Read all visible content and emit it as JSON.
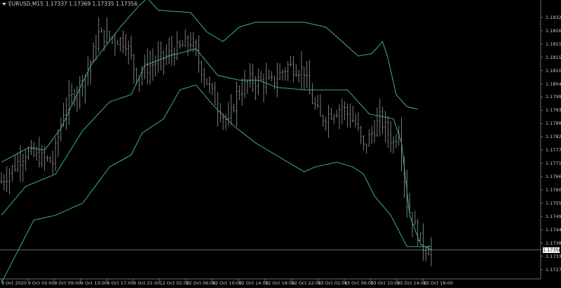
{
  "header": {
    "symbol_timeframe": "EURUSD,M15",
    "ohlc": "1.17337 1.17369 1.17335 1.17356"
  },
  "price_axis": {
    "labels": [
      "1.18320",
      "1.18265",
      "1.18210",
      "1.18155",
      "1.18100",
      "1.18045",
      "1.17990",
      "1.17935",
      "1.17880",
      "1.17825",
      "1.17770",
      "1.17715",
      "1.17660",
      "1.17605",
      "1.17550",
      "1.17495",
      "1.17440",
      "1.17385",
      "1.17330",
      "1.17275"
    ],
    "current_price": "1.17356"
  },
  "time_axis": {
    "labels": [
      "9 Oct 2020",
      "9 Oct 05:00",
      "9 Oct 09:00",
      "9 Oct 13:00",
      "9 Oct 17:00",
      "9 Oct 21:00",
      "12 Oct 02:00",
      "12 Oct 06:00",
      "12 Oct 10:00",
      "12 Oct 14:00",
      "12 Oct 18:00",
      "12 Oct 22:00",
      "13 Oct 02:00",
      "13 Oct 06:00",
      "13 Oct 10:00",
      "13 Oct 14:00",
      "13 Oct 18:00"
    ]
  },
  "colors": {
    "background": "#000000",
    "bars": "#9a9a9a",
    "bands": "#3cb371",
    "axis_text": "#c8c8c8",
    "axis_line": "#6e6e6e"
  },
  "chart_data": {
    "type": "line",
    "symbol": "EURUSD",
    "timeframe": "M15",
    "bar_count": 160,
    "y_range": [
      1.17242,
      1.18369
    ],
    "close_price_path": [
      {
        "bar": 0,
        "price": 1.1764
      },
      {
        "bar": 9,
        "price": 1.1776
      },
      {
        "bar": 19,
        "price": 1.1772
      },
      {
        "bar": 23,
        "price": 1.1793
      },
      {
        "bar": 32,
        "price": 1.181
      },
      {
        "bar": 36,
        "price": 1.1825
      },
      {
        "bar": 46,
        "price": 1.1822
      },
      {
        "bar": 50,
        "price": 1.1808
      },
      {
        "bar": 55,
        "price": 1.1812
      },
      {
        "bar": 64,
        "price": 1.1818
      },
      {
        "bar": 70,
        "price": 1.1822
      },
      {
        "bar": 75,
        "price": 1.1808
      },
      {
        "bar": 80,
        "price": 1.1795
      },
      {
        "bar": 84,
        "price": 1.1788
      },
      {
        "bar": 87,
        "price": 1.18
      },
      {
        "bar": 92,
        "price": 1.1806
      },
      {
        "bar": 100,
        "price": 1.1805
      },
      {
        "bar": 106,
        "price": 1.1812
      },
      {
        "bar": 112,
        "price": 1.181
      },
      {
        "bar": 114,
        "price": 1.18
      },
      {
        "bar": 118,
        "price": 1.179
      },
      {
        "bar": 126,
        "price": 1.1795
      },
      {
        "bar": 131,
        "price": 1.1788
      },
      {
        "bar": 134,
        "price": 1.1778
      },
      {
        "bar": 140,
        "price": 1.179
      },
      {
        "bar": 145,
        "price": 1.178
      },
      {
        "bar": 147,
        "price": 1.1786
      },
      {
        "bar": 150,
        "price": 1.1755
      },
      {
        "bar": 153,
        "price": 1.1745
      },
      {
        "bar": 156,
        "price": 1.1737
      },
      {
        "bar": 159,
        "price": 1.17356
      }
    ],
    "band_upper": [
      {
        "bar": 0,
        "price": 1.1772
      },
      {
        "bar": 10,
        "price": 1.1778
      },
      {
        "bar": 16,
        "price": 1.1777
      },
      {
        "bar": 22,
        "price": 1.1786
      },
      {
        "bar": 33,
        "price": 1.1812
      },
      {
        "bar": 44,
        "price": 1.1828
      },
      {
        "bar": 51,
        "price": 1.1837
      },
      {
        "bar": 54,
        "price": 1.184
      },
      {
        "bar": 58,
        "price": 1.1835
      },
      {
        "bar": 70,
        "price": 1.1834
      },
      {
        "bar": 76,
        "price": 1.1826
      },
      {
        "bar": 82,
        "price": 1.1822
      },
      {
        "bar": 88,
        "price": 1.1828
      },
      {
        "bar": 94,
        "price": 1.183
      },
      {
        "bar": 102,
        "price": 1.183
      },
      {
        "bar": 112,
        "price": 1.183
      },
      {
        "bar": 120,
        "price": 1.1828
      },
      {
        "bar": 126,
        "price": 1.1822
      },
      {
        "bar": 132,
        "price": 1.1816
      },
      {
        "bar": 137,
        "price": 1.1817
      },
      {
        "bar": 141,
        "price": 1.1822
      },
      {
        "bar": 143,
        "price": 1.1815
      },
      {
        "bar": 146,
        "price": 1.18
      },
      {
        "bar": 150,
        "price": 1.1795
      },
      {
        "bar": 154,
        "price": 1.1794
      }
    ],
    "band_middle": [
      {
        "bar": 0,
        "price": 1.175
      },
      {
        "bar": 9,
        "price": 1.1762
      },
      {
        "bar": 20,
        "price": 1.1767
      },
      {
        "bar": 30,
        "price": 1.1785
      },
      {
        "bar": 40,
        "price": 1.1797
      },
      {
        "bar": 48,
        "price": 1.18
      },
      {
        "bar": 53,
        "price": 1.1812
      },
      {
        "bar": 62,
        "price": 1.1816
      },
      {
        "bar": 72,
        "price": 1.1819
      },
      {
        "bar": 80,
        "price": 1.1808
      },
      {
        "bar": 88,
        "price": 1.1806
      },
      {
        "bar": 95,
        "price": 1.1806
      },
      {
        "bar": 102,
        "price": 1.1803
      },
      {
        "bar": 112,
        "price": 1.1802
      },
      {
        "bar": 128,
        "price": 1.1802
      },
      {
        "bar": 136,
        "price": 1.1792
      },
      {
        "bar": 145,
        "price": 1.179
      },
      {
        "bar": 148,
        "price": 1.178
      },
      {
        "bar": 151,
        "price": 1.175
      },
      {
        "bar": 155,
        "price": 1.1738
      },
      {
        "bar": 159,
        "price": 1.17356
      }
    ],
    "band_lower": [
      {
        "bar": 0,
        "price": 1.1722
      },
      {
        "bar": 6,
        "price": 1.1735
      },
      {
        "bar": 12,
        "price": 1.1748
      },
      {
        "bar": 20,
        "price": 1.175
      },
      {
        "bar": 30,
        "price": 1.1755
      },
      {
        "bar": 40,
        "price": 1.177
      },
      {
        "bar": 48,
        "price": 1.1775
      },
      {
        "bar": 52,
        "price": 1.1784
      },
      {
        "bar": 60,
        "price": 1.179
      },
      {
        "bar": 66,
        "price": 1.1802
      },
      {
        "bar": 72,
        "price": 1.1804
      },
      {
        "bar": 78,
        "price": 1.1796
      },
      {
        "bar": 86,
        "price": 1.1787
      },
      {
        "bar": 94,
        "price": 1.178
      },
      {
        "bar": 100,
        "price": 1.1776
      },
      {
        "bar": 106,
        "price": 1.1772
      },
      {
        "bar": 112,
        "price": 1.1768
      },
      {
        "bar": 116,
        "price": 1.177
      },
      {
        "bar": 124,
        "price": 1.1772
      },
      {
        "bar": 130,
        "price": 1.177
      },
      {
        "bar": 134,
        "price": 1.1767
      },
      {
        "bar": 138,
        "price": 1.1758
      },
      {
        "bar": 144,
        "price": 1.175
      },
      {
        "bar": 150,
        "price": 1.1737
      },
      {
        "bar": 159,
        "price": 1.1737
      }
    ]
  }
}
